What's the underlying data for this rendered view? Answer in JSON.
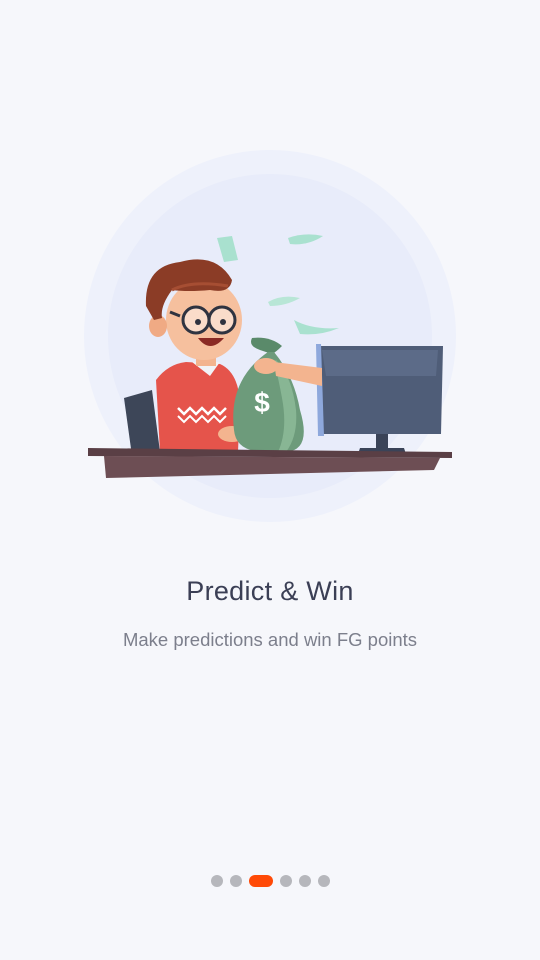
{
  "onboarding": {
    "title": "Predict & Win",
    "subtitle": "Make predictions and win FG points",
    "illustration_icon": "man-with-money-bag-at-computer",
    "current_page": 3,
    "total_pages": 6,
    "accent_color": "#ff4a07"
  }
}
